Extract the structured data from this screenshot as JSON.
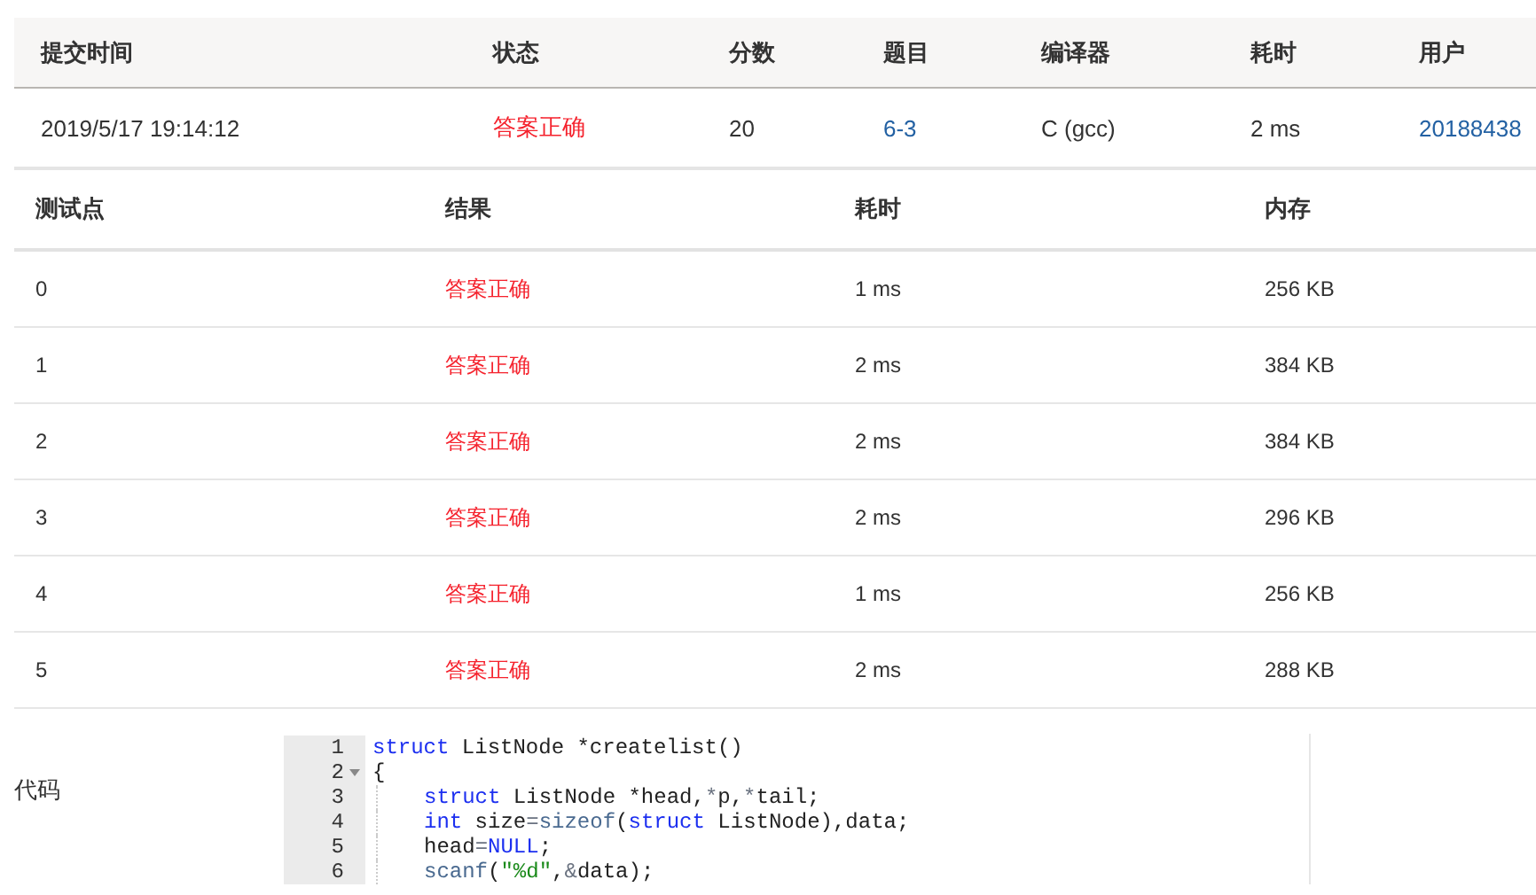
{
  "submission": {
    "columns": [
      "提交时间",
      "状态",
      "分数",
      "题目",
      "编译器",
      "耗时",
      "用户"
    ],
    "row": [
      {
        "text": "2019/5/17 19:14:12",
        "kind": "plain"
      },
      {
        "text": "答案正确",
        "kind": "status"
      },
      {
        "text": "20",
        "kind": "plain"
      },
      {
        "text": "6-3",
        "kind": "link"
      },
      {
        "text": "C (gcc)",
        "kind": "plain"
      },
      {
        "text": "2 ms",
        "kind": "plain"
      },
      {
        "text": "20188438",
        "kind": "link"
      }
    ]
  },
  "tests": {
    "columns": [
      "测试点",
      "结果",
      "耗时",
      "内存"
    ],
    "rows": [
      {
        "point": "0",
        "result": "答案正确",
        "time": "1 ms",
        "memory": "256 KB"
      },
      {
        "point": "1",
        "result": "答案正确",
        "time": "2 ms",
        "memory": "384 KB"
      },
      {
        "point": "2",
        "result": "答案正确",
        "time": "2 ms",
        "memory": "384 KB"
      },
      {
        "point": "3",
        "result": "答案正确",
        "time": "2 ms",
        "memory": "296 KB"
      },
      {
        "point": "4",
        "result": "答案正确",
        "time": "1 ms",
        "memory": "256 KB"
      },
      {
        "point": "5",
        "result": "答案正确",
        "time": "2 ms",
        "memory": "288 KB"
      }
    ]
  },
  "code": {
    "label": "代码",
    "lines": [
      {
        "number": "1",
        "fold": false,
        "indent": false,
        "tokens": [
          {
            "kind": "keyword",
            "text": "struct"
          },
          {
            "kind": "plain",
            "text": " ListNode *createlist()"
          }
        ]
      },
      {
        "number": "2",
        "fold": true,
        "indent": false,
        "tokens": [
          {
            "kind": "plain",
            "text": "{"
          }
        ]
      },
      {
        "number": "3",
        "fold": false,
        "indent": true,
        "tokens": [
          {
            "kind": "keyword",
            "text": "struct"
          },
          {
            "kind": "plain",
            "text": " ListNode *head,"
          },
          {
            "kind": "op",
            "text": "*"
          },
          {
            "kind": "plain",
            "text": "p,"
          },
          {
            "kind": "op",
            "text": "*"
          },
          {
            "kind": "plain",
            "text": "tail;"
          }
        ]
      },
      {
        "number": "4",
        "fold": false,
        "indent": true,
        "tokens": [
          {
            "kind": "keyword",
            "text": "int"
          },
          {
            "kind": "plain",
            "text": " size"
          },
          {
            "kind": "op",
            "text": "="
          },
          {
            "kind": "func",
            "text": "sizeof"
          },
          {
            "kind": "plain",
            "text": "("
          },
          {
            "kind": "keyword",
            "text": "struct"
          },
          {
            "kind": "plain",
            "text": " ListNode),data;"
          }
        ]
      },
      {
        "number": "5",
        "fold": false,
        "indent": true,
        "tokens": [
          {
            "kind": "plain",
            "text": "head"
          },
          {
            "kind": "op",
            "text": "="
          },
          {
            "kind": "keyword",
            "text": "NULL"
          },
          {
            "kind": "plain",
            "text": ";"
          }
        ]
      },
      {
        "number": "6",
        "fold": false,
        "indent": true,
        "tokens": [
          {
            "kind": "func",
            "text": "scanf"
          },
          {
            "kind": "plain",
            "text": "("
          },
          {
            "kind": "string",
            "text": "\"%d\""
          },
          {
            "kind": "plain",
            "text": ","
          },
          {
            "kind": "op",
            "text": "&"
          },
          {
            "kind": "plain",
            "text": "data);"
          }
        ]
      }
    ]
  }
}
